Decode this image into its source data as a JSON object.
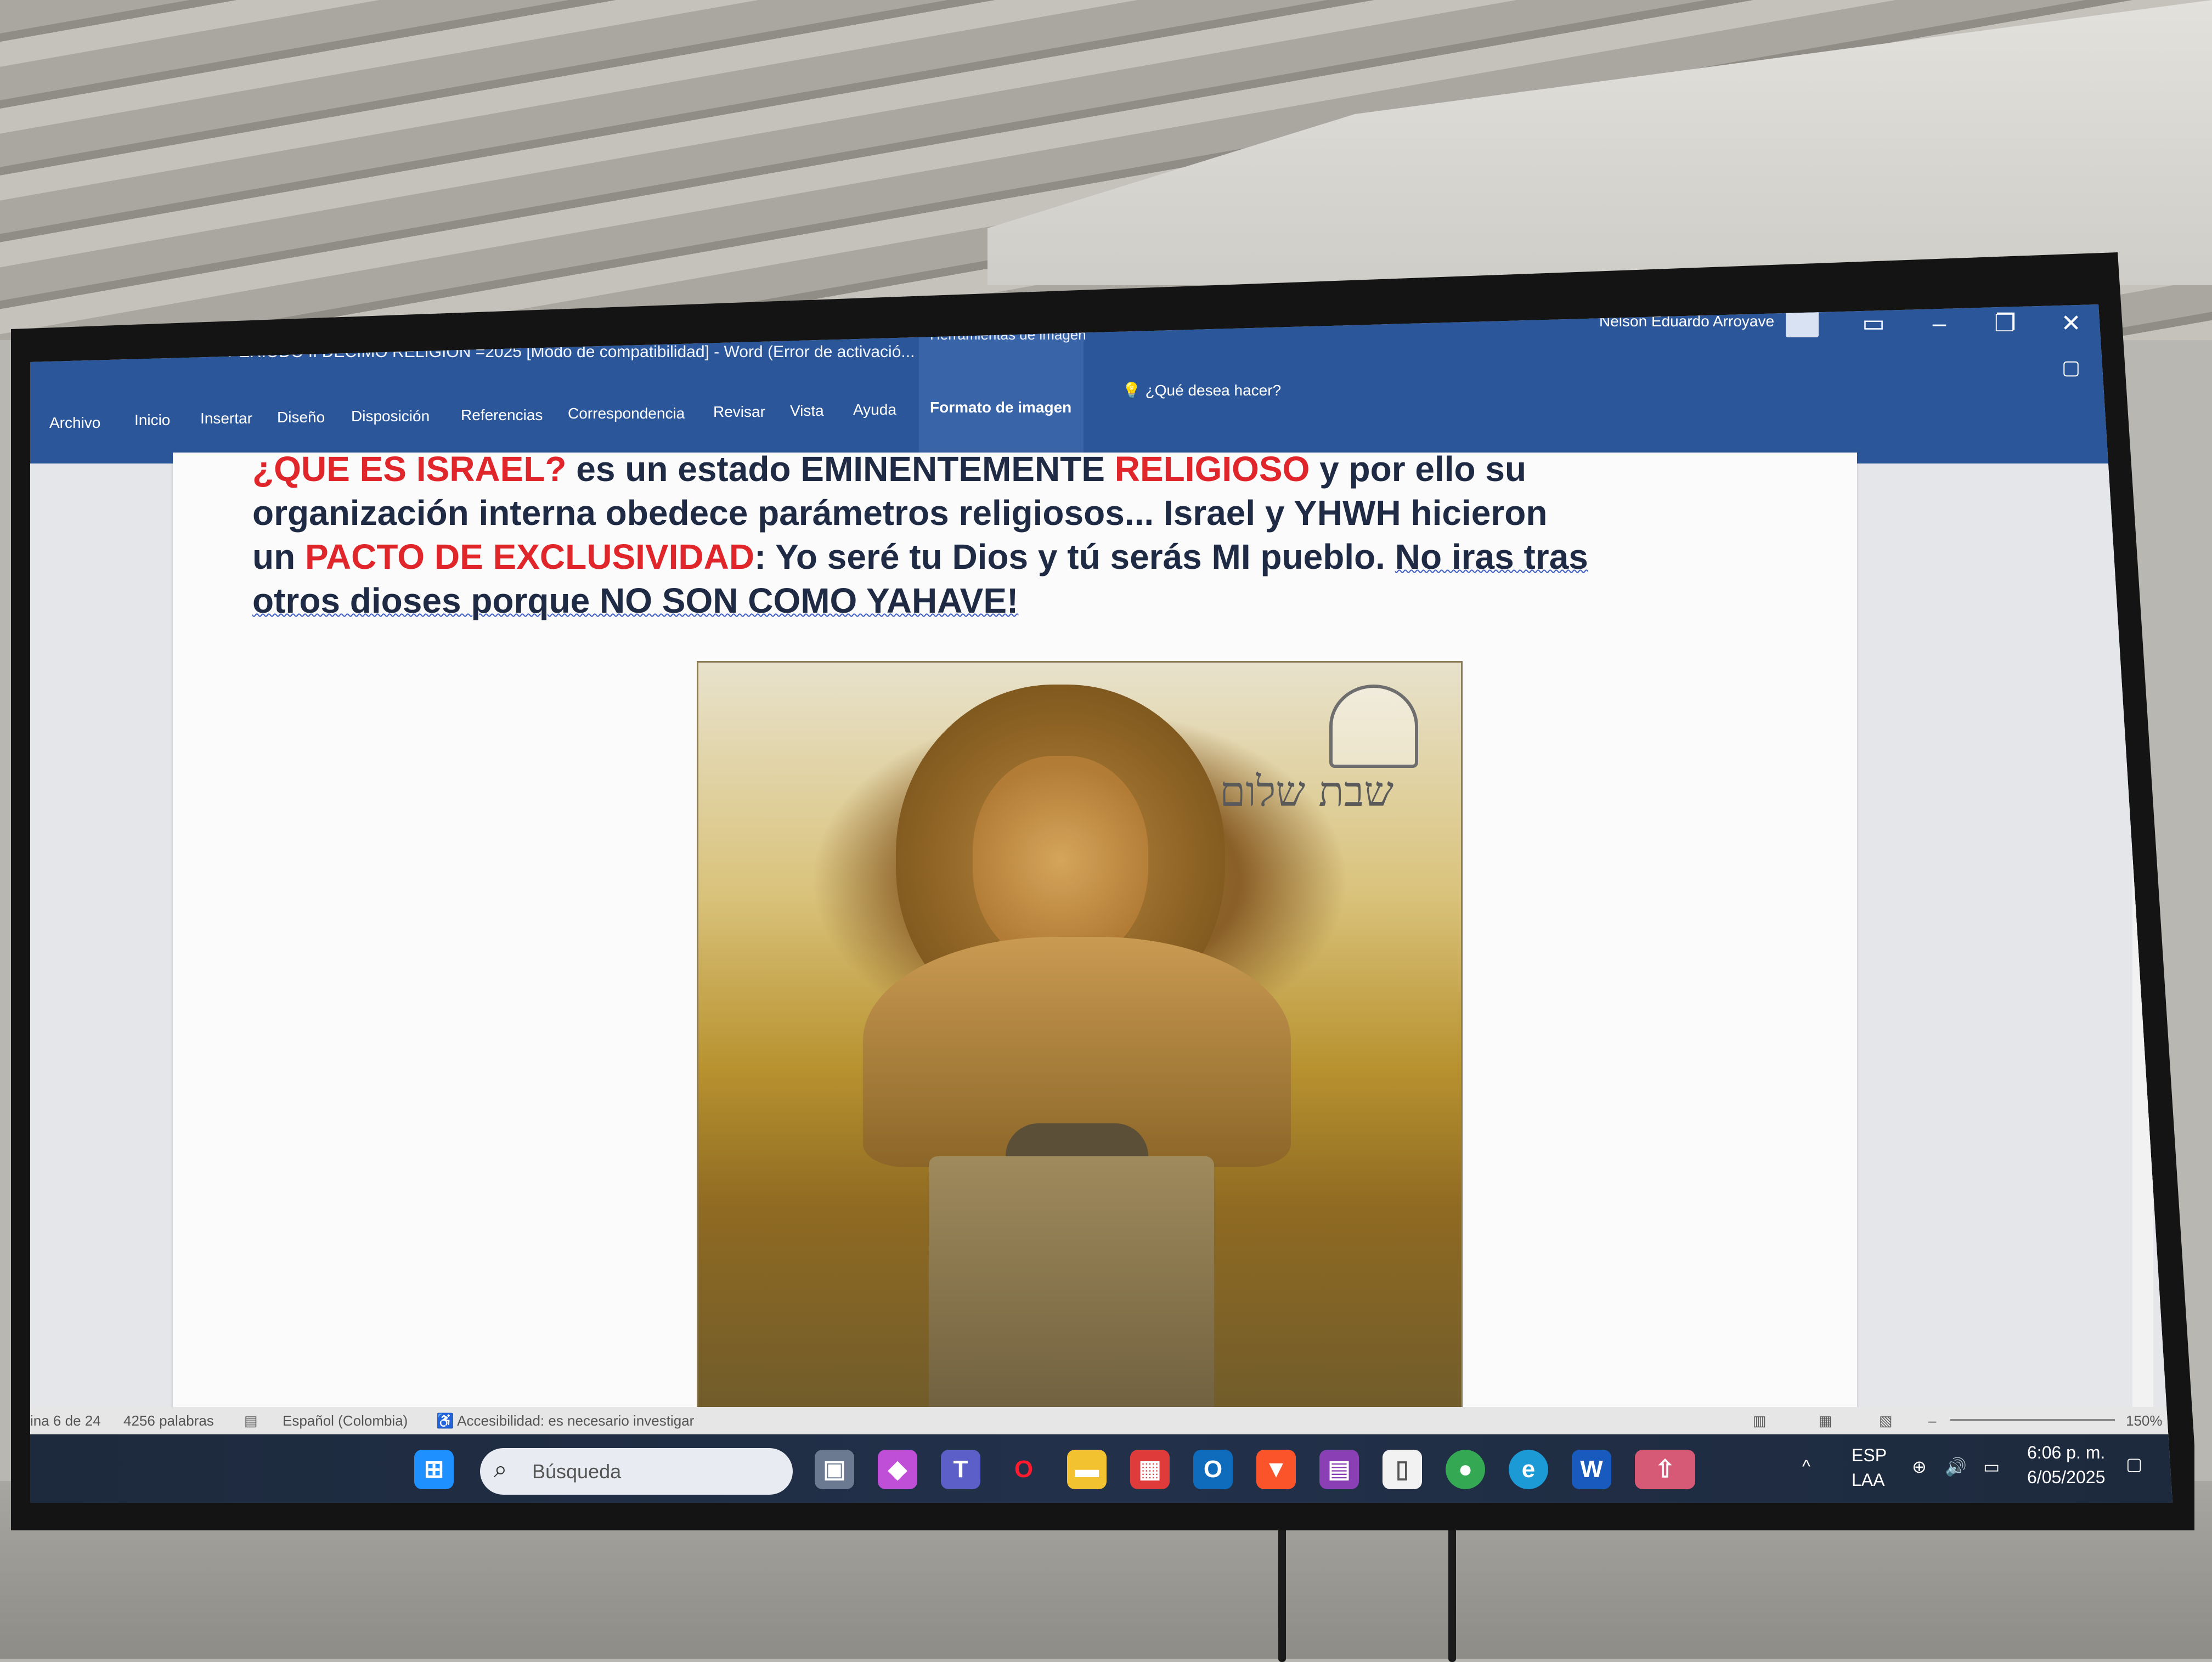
{
  "window": {
    "doc_title": "PERIODO II DECIMO RELIGION =2025 [Modo de compatibilidad]  -  Word (Error de activació...",
    "context_tab_group": "Herramientas de imagen",
    "user_name": "Nelson Eduardo Arroyave",
    "tell_me": "¿Qué desea hacer?"
  },
  "ribbon": {
    "tabs": [
      "Archivo",
      "Inicio",
      "Insertar",
      "Diseño",
      "Disposición",
      "Referencias",
      "Correspondencia",
      "Revisar",
      "Vista",
      "Ayuda",
      "Formato de imagen"
    ]
  },
  "document": {
    "line1_a": "¿QUE ES ISRAEL?",
    "line1_b": " es un estado EMINENTEMENTE ",
    "line1_c": "RELIGIOSO",
    "line1_d": " y por ello su",
    "line2": "organización interna obedece parámetros religiosos...  Israel y YHWH hicieron",
    "line3_a": "un ",
    "line3_b": "PACTO DE EXCLUSIVIDAD",
    "line3_c": ": Yo seré tu Dios y tú serás MI pueblo. ",
    "line3_d": "No iras tras",
    "line4": "otros dioses porque NO SON COMO YAHAVE!",
    "image_caption_hebrew": "שבת שלום"
  },
  "status": {
    "page": "ina 6 de 24",
    "words": "4256 palabras",
    "language": "Español (Colombia)",
    "accessibility": "Accesibilidad: es necesario investigar",
    "zoom": "150%"
  },
  "taskbar": {
    "search_placeholder": "Búsqueda",
    "lang_top": "ESP",
    "lang_bottom": "LAA",
    "time": "6:06 p. m.",
    "date": "6/05/2025"
  },
  "colors": {
    "word_blue": "#2b579a",
    "heading_red": "#e0262a",
    "text_navy": "#1f2a44"
  }
}
